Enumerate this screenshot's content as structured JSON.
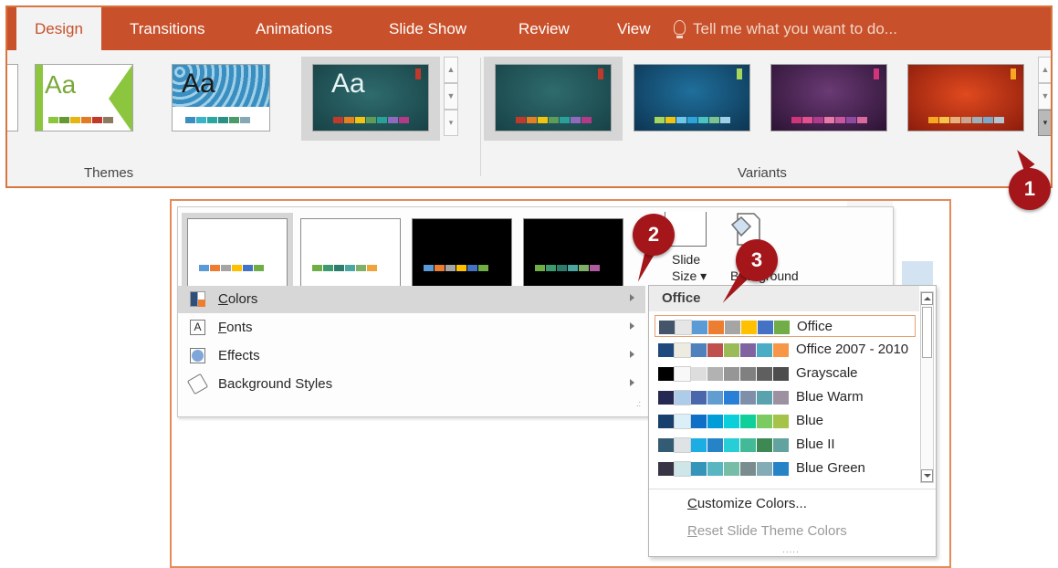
{
  "ribbon": {
    "tabs": [
      {
        "label": "Design",
        "active": true
      },
      {
        "label": "Transitions"
      },
      {
        "label": "Animations"
      },
      {
        "label": "Slide Show"
      },
      {
        "label": "Review"
      },
      {
        "label": "View"
      }
    ],
    "tell_me": "Tell me what you want to do...",
    "tell_me_icon": "lightbulb-icon",
    "themes_label": "Themes",
    "variants_label": "Variants",
    "theme_thumb_text": "Aa"
  },
  "callouts": [
    "1",
    "2",
    "3"
  ],
  "variant_menu": {
    "items": [
      {
        "label_pre": "",
        "label_u": "C",
        "label_post": "olors",
        "icon": "color-palette-icon"
      },
      {
        "label_pre": "",
        "label_u": "F",
        "label_post": "onts",
        "icon": "font-a-icon"
      },
      {
        "label_pre": "",
        "label_u": "",
        "label_post": "Effects",
        "icon": "effects-circle-icon"
      },
      {
        "label_pre": "",
        "label_u": "",
        "label_post": "Background Styles",
        "icon": "paint-bucket-icon"
      }
    ],
    "slide_label": "Slide",
    "size_label": "Size ▾",
    "background_label": "Background"
  },
  "colors_menu": {
    "header": "Office",
    "palettes": [
      {
        "name": "Office",
        "colors": [
          "#44546a",
          "#e7e6e6",
          "#5b9bd5",
          "#ed7d31",
          "#a5a5a5",
          "#ffc000",
          "#4472c4",
          "#70ad47"
        ]
      },
      {
        "name": "Office 2007 - 2010",
        "colors": [
          "#1f497d",
          "#eeece1",
          "#4f81bd",
          "#c0504d",
          "#9bbb59",
          "#8064a2",
          "#4bacc6",
          "#f79646"
        ]
      },
      {
        "name": "Grayscale",
        "colors": [
          "#000000",
          "#f8f8f8",
          "#dddddd",
          "#b2b2b2",
          "#969696",
          "#808080",
          "#5f5f5f",
          "#4d4d4d"
        ]
      },
      {
        "name": "Blue Warm",
        "colors": [
          "#242852",
          "#acccea",
          "#4a66ac",
          "#629dd1",
          "#297fd5",
          "#7f8fa9",
          "#5aa2ae",
          "#9d90a0"
        ]
      },
      {
        "name": "Blue",
        "colors": [
          "#17406d",
          "#dbeff9",
          "#0f6fc6",
          "#009dd9",
          "#0bd0d9",
          "#10cf9b",
          "#7cca62",
          "#a5c249"
        ]
      },
      {
        "name": "Blue II",
        "colors": [
          "#335b74",
          "#dfe3e5",
          "#1cade4",
          "#2683c6",
          "#27ced7",
          "#42ba97",
          "#3e8853",
          "#62a39f"
        ]
      },
      {
        "name": "Blue Green",
        "colors": [
          "#373545",
          "#cee6e7",
          "#3494ba",
          "#58b6c0",
          "#75bda7",
          "#7a8c8e",
          "#84acb6",
          "#2683c6"
        ]
      }
    ],
    "customize_u": "C",
    "customize_rest": "ustomize Colors...",
    "reset_u": "R",
    "reset_rest": "eset Slide Theme Colors"
  }
}
